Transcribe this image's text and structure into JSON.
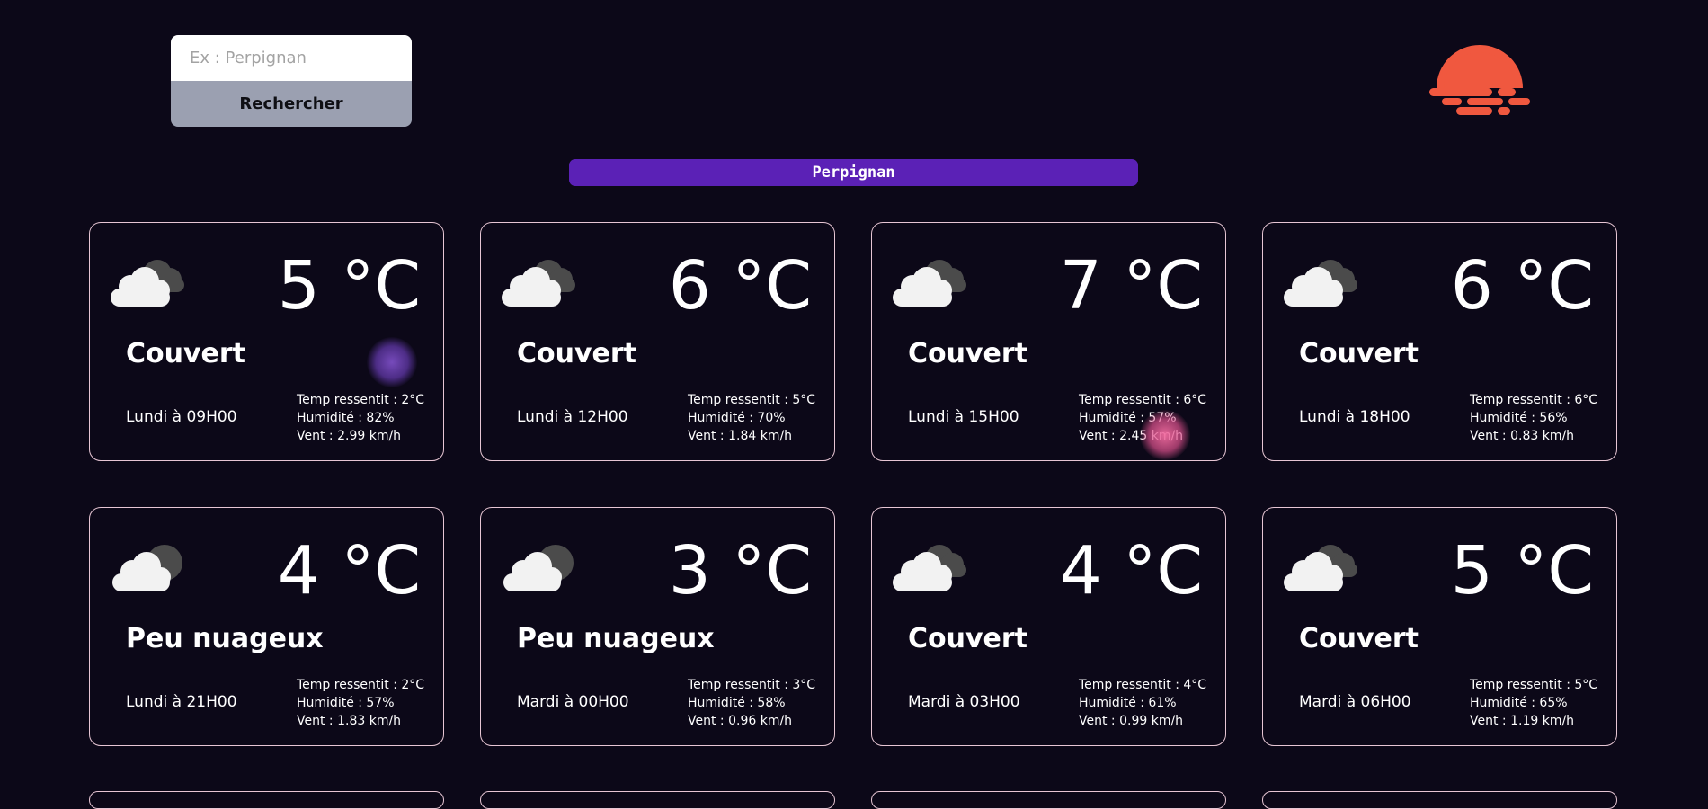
{
  "search": {
    "placeholder": "Ex : Perpignan",
    "value": "",
    "button_label": "Rechercher"
  },
  "logo": {
    "icon": "sunset-icon",
    "color": "#f0583f"
  },
  "city": {
    "name": "Perpignan",
    "color": "#5b21b6"
  },
  "forecasts": [
    {
      "icon": "overcast-cloud-icon",
      "temp": "5 °C",
      "desc": "Couvert",
      "time": "Lundi à 09H00",
      "feels": "Temp ressentit : 2°C",
      "humidity": "Humidité : 82%",
      "wind": "Vent : 2.99 km/h"
    },
    {
      "icon": "overcast-cloud-icon",
      "temp": "6 °C",
      "desc": "Couvert",
      "time": "Lundi à 12H00",
      "feels": "Temp ressentit : 5°C",
      "humidity": "Humidité : 70%",
      "wind": "Vent : 1.84 km/h"
    },
    {
      "icon": "overcast-cloud-icon",
      "temp": "7 °C",
      "desc": "Couvert",
      "time": "Lundi à 15H00",
      "feels": "Temp ressentit : 6°C",
      "humidity": "Humidité : 57%",
      "wind": "Vent : 2.45 km/h"
    },
    {
      "icon": "overcast-cloud-icon",
      "temp": "6 °C",
      "desc": "Couvert",
      "time": "Lundi à 18H00",
      "feels": "Temp ressentit : 6°C",
      "humidity": "Humidité : 56%",
      "wind": "Vent : 0.83 km/h"
    },
    {
      "icon": "partly-cloudy-night-icon",
      "temp": "4 °C",
      "desc": "Peu nuageux",
      "time": "Lundi à 21H00",
      "feels": "Temp ressentit : 2°C",
      "humidity": "Humidité : 57%",
      "wind": "Vent : 1.83 km/h"
    },
    {
      "icon": "partly-cloudy-night-icon",
      "temp": "3 °C",
      "desc": "Peu nuageux",
      "time": "Mardi à 00H00",
      "feels": "Temp ressentit : 3°C",
      "humidity": "Humidité : 58%",
      "wind": "Vent : 0.96 km/h"
    },
    {
      "icon": "overcast-cloud-icon",
      "temp": "4 °C",
      "desc": "Couvert",
      "time": "Mardi à 03H00",
      "feels": "Temp ressentit : 4°C",
      "humidity": "Humidité : 61%",
      "wind": "Vent : 0.99 km/h"
    },
    {
      "icon": "overcast-cloud-icon",
      "temp": "5 °C",
      "desc": "Couvert",
      "time": "Mardi à 06H00",
      "feels": "Temp ressentit : 5°C",
      "humidity": "Humidité : 65%",
      "wind": "Vent : 1.19 km/h"
    }
  ],
  "colors": {
    "background": "#0c0818",
    "card_border": "#e7c6d4",
    "search_button": "#9ba0b1"
  }
}
